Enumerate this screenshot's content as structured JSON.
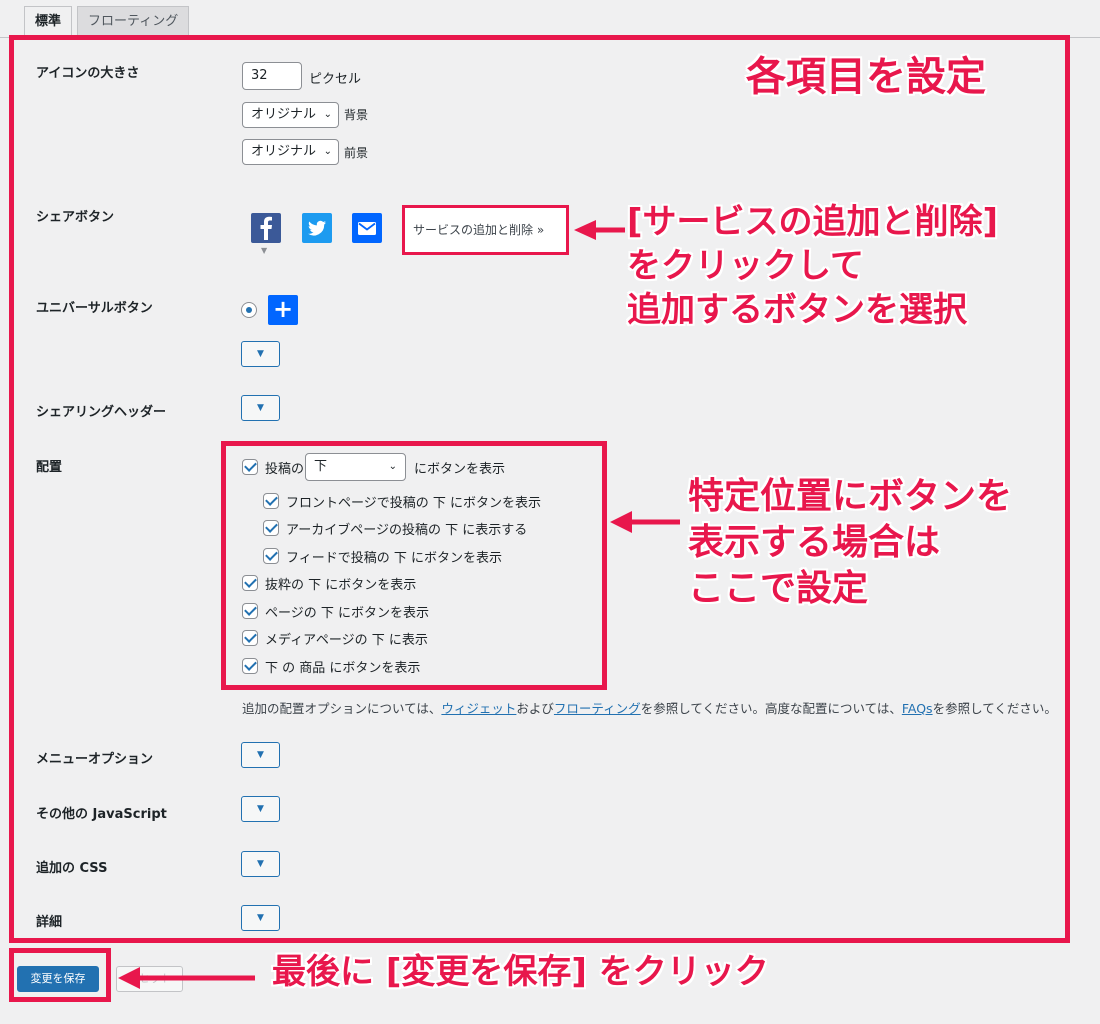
{
  "tabs": [
    "標準",
    "フローティング"
  ],
  "icon_size": {
    "label": "アイコンの大きさ",
    "value": "32",
    "unit": "ピクセル",
    "background_select": "オリジナル",
    "background_label": "背景",
    "foreground_select": "オリジナル",
    "foreground_label": "前景"
  },
  "share_buttons": {
    "label": "シェアボタン",
    "services": [
      "facebook-icon",
      "twitter-icon",
      "email-icon"
    ],
    "add_remove_label": "サービスの追加と削除 »"
  },
  "universal_button": {
    "label": "ユニバーサルボタン",
    "toggle_symbol": "▼"
  },
  "sharing_header": {
    "label": "シェアリングヘッダー"
  },
  "placement": {
    "label": "配置",
    "posts_prefix": "投稿の",
    "posts_select": "下",
    "posts_suffix": "にボタンを表示",
    "options": [
      "フロントページで投稿の 下 にボタンを表示",
      "アーカイブページの投稿の 下 に表示する",
      "フィードで投稿の 下 にボタンを表示",
      "抜粋の 下 にボタンを表示",
      "ページの 下 にボタンを表示",
      "メディアページの 下 に表示",
      "下 の 商品 にボタンを表示"
    ],
    "help_prefix": "追加の配置オプションについては、",
    "help_link1": "ウィジェット",
    "help_mid1": "および",
    "help_link2": "フローティング",
    "help_mid2": "を参照してください。高度な配置については、",
    "help_link3": "FAQs",
    "help_suffix": "を参照してください。"
  },
  "menu_options": {
    "label": "メニューオプション"
  },
  "other_js": {
    "label": "その他の JavaScript"
  },
  "additional_css": {
    "label": "追加の CSS"
  },
  "details": {
    "label": "詳細"
  },
  "buttons": {
    "save": "変更を保存",
    "reset": "リセット"
  },
  "annotations": {
    "top": "各項目を設定",
    "services_line1": "[サービスの追加と削除]",
    "services_line2": "をクリックして",
    "services_line3": "追加するボタンを選択",
    "placement_line1": "特定位置にボタンを",
    "placement_line2": "表示する場合は",
    "placement_line3": "ここで設定",
    "save": "最後に [変更を保存] をクリック"
  },
  "colors": {
    "annotation": "#e8174c",
    "primary": "#2271b1",
    "facebook": "#1877f2",
    "twitter": "#1d9bf0",
    "email": "#0166ff"
  }
}
